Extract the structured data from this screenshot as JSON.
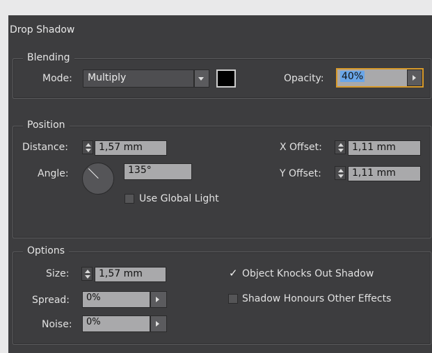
{
  "dialog": {
    "title": "Drop Shadow"
  },
  "blending": {
    "label": "Blending",
    "mode_label": "Mode:",
    "mode_value": "Multiply",
    "shadow_color": "#000000",
    "opacity_label": "Opacity:",
    "opacity_value": "40%"
  },
  "position": {
    "label": "Position",
    "distance_label": "Distance:",
    "distance_value": "1,57 mm",
    "angle_label": "Angle:",
    "angle_value": "135°",
    "use_global_light_label": "Use Global Light",
    "use_global_light_checked": false,
    "x_offset_label": "X Offset:",
    "x_offset_value": "1,11 mm",
    "y_offset_label": "Y Offset:",
    "y_offset_value": "1,11 mm"
  },
  "options": {
    "label": "Options",
    "size_label": "Size:",
    "size_value": "1,57 mm",
    "spread_label": "Spread:",
    "spread_value": "0%",
    "noise_label": "Noise:",
    "noise_value": "0%",
    "knocks_out_label": "Object Knocks Out Shadow",
    "knocks_out_checked": true,
    "honours_label": "Shadow Honours Other Effects",
    "honours_checked": false
  },
  "colors": {
    "panel_bg": "#3d3d3f",
    "field_bg": "#a9a9ab",
    "selection": "#6aa6e8"
  }
}
